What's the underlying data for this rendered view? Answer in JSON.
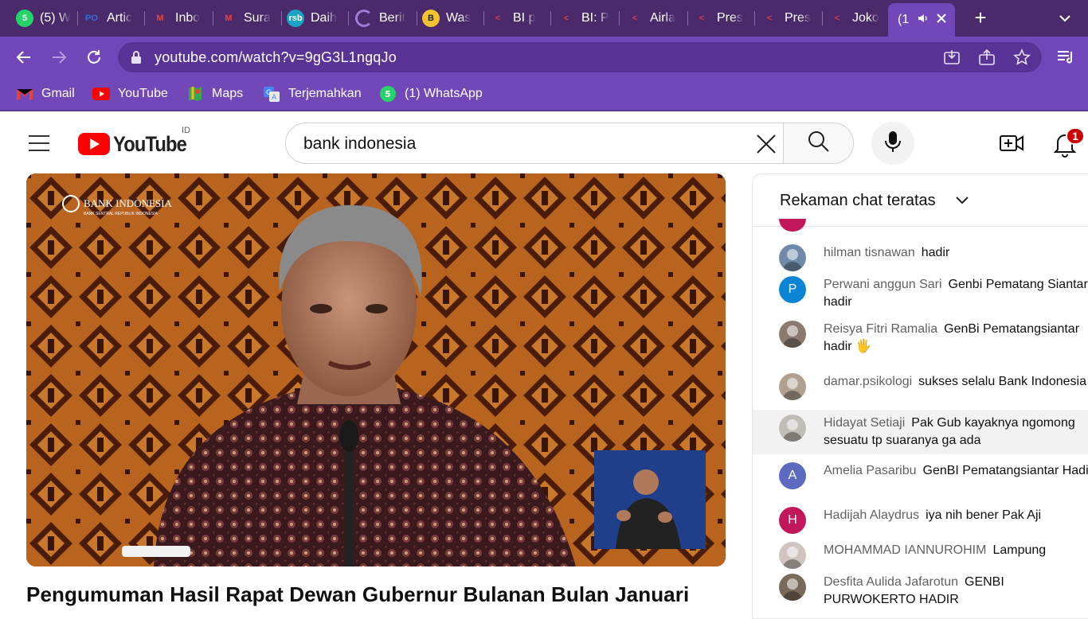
{
  "browser": {
    "tabs": [
      {
        "label": "(5) W",
        "icon": "whatsapp-icon",
        "glyph": "5"
      },
      {
        "label": "Artic",
        "icon": "po-icon",
        "glyph": "PO"
      },
      {
        "label": "Inbo",
        "icon": "gmail-icon",
        "glyph": "M"
      },
      {
        "label": "Sura",
        "icon": "gmail-icon",
        "glyph": "M"
      },
      {
        "label": "Daih",
        "icon": "rsb-icon",
        "glyph": "rsb"
      },
      {
        "label": "Berit",
        "icon": "loading-icon",
        "glyph": ""
      },
      {
        "label": "Was",
        "icon": "bitcoin-icon",
        "glyph": "B"
      },
      {
        "label": "BI p",
        "icon": "bi-icon",
        "glyph": "<"
      },
      {
        "label": "BI: P",
        "icon": "bi-icon",
        "glyph": "<"
      },
      {
        "label": "Airla",
        "icon": "bi-icon",
        "glyph": "<"
      },
      {
        "label": "Pres",
        "icon": "bi-icon",
        "glyph": "<"
      },
      {
        "label": "Pres",
        "icon": "bi-icon",
        "glyph": "<"
      },
      {
        "label": "Joko",
        "icon": "bi-icon",
        "glyph": "<"
      }
    ],
    "active_tab": {
      "label": "(1",
      "audio_icon": "speaker-icon",
      "close_icon": "close-icon"
    },
    "url": "youtube.com/watch?v=9gG3L1ngqJo",
    "bookmarks": [
      {
        "label": "Gmail",
        "icon": "gmail-icon"
      },
      {
        "label": "YouTube",
        "icon": "youtube-icon"
      },
      {
        "label": "Maps",
        "icon": "maps-icon"
      },
      {
        "label": "Terjemahkan",
        "icon": "translate-icon"
      },
      {
        "label": "(1) WhatsApp",
        "icon": "whatsapp-icon"
      }
    ],
    "colors": {
      "frame": "#4b2a6b",
      "toolbar": "#7248b8"
    }
  },
  "youtube": {
    "logo_text": "YouTube",
    "region": "ID",
    "search_value": "bank indonesia",
    "notification_count": "1",
    "video": {
      "watermark": "BANK INDONESIA",
      "watermark_sub": "BANK SENTRAL REPUBLIK INDONESIA",
      "title": "Pengumuman Hasil Rapat Dewan Gubernur Bulanan Bulan Januari"
    },
    "chat": {
      "header": "Rekaman chat teratas",
      "messages": [
        {
          "author": "hilman tisnawan",
          "text": "hadir",
          "avatar": "photo",
          "color": "#6f8aa8",
          "highlight": false
        },
        {
          "author": "Perwani anggun Sari",
          "text": "Genbi Pematang Siantar hadir",
          "avatar": "P",
          "color": "#0b84d6",
          "highlight": false
        },
        {
          "author": "Reisya Fitri Ramalia",
          "text": "GenBi Pematangsiantar hadir 🖐",
          "avatar": "photo",
          "color": "#8a7a70",
          "highlight": false
        },
        {
          "author": "damar.psikologi",
          "text": "sukses selalu Bank Indonesia",
          "avatar": "photo",
          "color": "#b0a090",
          "highlight": false
        },
        {
          "author": "Hidayat Setiaji",
          "text": "Pak Gub kayaknya ngomong sesuatu tp suaranya ga ada",
          "avatar": "photo",
          "color": "#c0bcb8",
          "highlight": true
        },
        {
          "author": "Amelia Pasaribu",
          "text": "GenBI Pematangsiantar Hadir",
          "avatar": "A",
          "color": "#5c6bc0",
          "highlight": false
        },
        {
          "author": "Hadijah Alaydrus",
          "text": "iya nih bener Pak Aji",
          "avatar": "H",
          "color": "#c2185b",
          "highlight": false
        },
        {
          "author": "MOHAMMAD IANNUROHIM",
          "text": "Lampung",
          "avatar": "photo",
          "color": "#d0c4c0",
          "highlight": false
        },
        {
          "author": "Desfita Aulida Jafarotun",
          "text": "GENBI PURWOKERTO HADIR",
          "avatar": "photo",
          "color": "#7a6a5a",
          "highlight": false
        }
      ]
    }
  }
}
